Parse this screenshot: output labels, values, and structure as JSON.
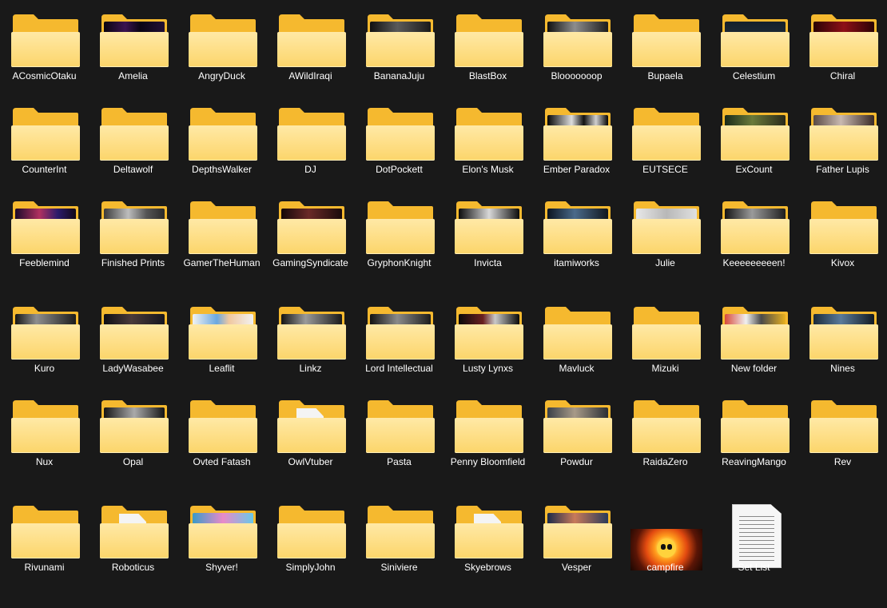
{
  "explorer": {
    "items": [
      {
        "name": "ACosmicOtaku",
        "kind": "folder",
        "preview": ""
      },
      {
        "name": "Amelia",
        "kind": "folder",
        "preview": "linear-gradient(90deg,#09050f,#3b1350 35%,#0a0414 60%,#221035)"
      },
      {
        "name": "AngryDuck",
        "kind": "folder",
        "preview": ""
      },
      {
        "name": "AWildIraqi",
        "kind": "folder",
        "preview": ""
      },
      {
        "name": "BananaJuju",
        "kind": "folder",
        "preview": "linear-gradient(90deg,#101010,#5a5a5a 45%,#1a1a1a)"
      },
      {
        "name": "BlastBox",
        "kind": "folder",
        "preview": ""
      },
      {
        "name": "Blooooooop",
        "kind": "folder",
        "preview": "linear-gradient(90deg,#0f0f0f,#8d8d8d 45%,#1c1c1c)"
      },
      {
        "name": "Bupaela",
        "kind": "folder",
        "preview": ""
      },
      {
        "name": "Celestium",
        "kind": "folder",
        "preview": "linear-gradient(180deg,#15202b,#24313d)"
      },
      {
        "name": "Chiral",
        "kind": "folder",
        "preview": "linear-gradient(90deg,#2a0305,#8e1017 50%,#2a0305)"
      },
      {
        "name": "CounterInt",
        "kind": "folder",
        "preview": ""
      },
      {
        "name": "Deltawolf",
        "kind": "folder",
        "preview": ""
      },
      {
        "name": "DepthsWalker",
        "kind": "folder",
        "preview": ""
      },
      {
        "name": "DJ",
        "kind": "folder",
        "preview": ""
      },
      {
        "name": "DotPockett",
        "kind": "folder",
        "preview": ""
      },
      {
        "name": "Elon's Musk",
        "kind": "folder",
        "preview": ""
      },
      {
        "name": "Ember Paradox",
        "kind": "folder",
        "preview": "linear-gradient(90deg,#050505,#dcdcdc 40%,#111 60%,#cfcfcf 80%,#050505)"
      },
      {
        "name": "EUTSECE",
        "kind": "folder",
        "preview": ""
      },
      {
        "name": "ExCount",
        "kind": "folder",
        "preview": "linear-gradient(90deg,#1a2a1a,#6a7a3a 45%,#2a2a1a)"
      },
      {
        "name": "Father Lupis",
        "kind": "folder",
        "preview": "linear-gradient(90deg,#5a4a45,#c8b8b0 45%,#3a2a26)"
      },
      {
        "name": "Feeblemind",
        "kind": "folder",
        "preview": "linear-gradient(90deg,#1b0b2b,#b03060 40%,#2b1b6b 70%,#120818)"
      },
      {
        "name": "Finished Prints",
        "kind": "folder",
        "preview": "linear-gradient(90deg,#3a3a3a,#bdbdbd 40%,#555 70%,#2a2a2a)"
      },
      {
        "name": "GamerTheHuman",
        "kind": "folder",
        "preview": ""
      },
      {
        "name": "GamingSyndicate",
        "kind": "folder",
        "preview": "linear-gradient(90deg,#140808,#6a2a28 45%,#1a0b0b)"
      },
      {
        "name": "GryphonKnight",
        "kind": "folder",
        "preview": ""
      },
      {
        "name": "Invicta",
        "kind": "folder",
        "preview": "linear-gradient(90deg,#0c0c0c,#d8d8d8 50%,#0c0c0c)"
      },
      {
        "name": "itamiworks",
        "kind": "folder",
        "preview": "linear-gradient(90deg,#0b1420,#4a6a8a 45%,#10161e)"
      },
      {
        "name": "Julie",
        "kind": "folder",
        "preview": "linear-gradient(90deg,#e8e8e8,#b8b8b8 50%,#e0e0e0)"
      },
      {
        "name": "Keeeeeeeeen!",
        "kind": "folder",
        "preview": "linear-gradient(90deg,#141414,#9a9a9a 45%,#1e1e1e)"
      },
      {
        "name": "Kivox",
        "kind": "folder",
        "preview": ""
      },
      {
        "name": "Kuro",
        "kind": "folder",
        "preview": "linear-gradient(90deg,#161616,#8e8e8e 35%,#1c1c1c)"
      },
      {
        "name": "LadyWasabee",
        "kind": "folder",
        "preview": "linear-gradient(90deg,#0e0e14,#4a3a3a 45%,#16161e)"
      },
      {
        "name": "Leaflit",
        "kind": "folder",
        "preview": "linear-gradient(90deg,#f2f2f2,#6aa8e0 40%,#f0c8a0 60%,#f2f2f2)"
      },
      {
        "name": "Linkz",
        "kind": "folder",
        "preview": "linear-gradient(90deg,#141414,#9a9a9a 40%,#1a1a1a)"
      },
      {
        "name": "Lord Intellectual",
        "kind": "folder",
        "preview": "linear-gradient(90deg,#121212,#8a8a8a 45%,#1c1c1c)"
      },
      {
        "name": "Lusty Lynxs",
        "kind": "folder",
        "preview": "linear-gradient(90deg,#0a0a0a,#6a2020 40%,#c8c8c8 60%,#0a0a0a)"
      },
      {
        "name": "Mavluck",
        "kind": "folder",
        "preview": ""
      },
      {
        "name": "Mizuki",
        "kind": "folder",
        "preview": ""
      },
      {
        "name": "New folder",
        "kind": "folder",
        "preview": "linear-gradient(90deg,#d84a3a,#f0f0f0 35%,#4a4a4a 60%,#e8b020)"
      },
      {
        "name": "Nines",
        "kind": "folder",
        "preview": "linear-gradient(90deg,#1a2a3a,#5a7a9a 45%,#121a22)"
      },
      {
        "name": "Nux",
        "kind": "folder",
        "preview": ""
      },
      {
        "name": "Opal",
        "kind": "folder",
        "preview": "linear-gradient(90deg,#151515,#aaaaaa 50%,#151515)"
      },
      {
        "name": "Ovted Fatash",
        "kind": "folder",
        "preview": ""
      },
      {
        "name": "OwlVtuber",
        "kind": "folder-doc",
        "preview": ""
      },
      {
        "name": "Pasta",
        "kind": "folder",
        "preview": ""
      },
      {
        "name": "Penny Bloomfield",
        "kind": "folder",
        "preview": ""
      },
      {
        "name": "Powdur",
        "kind": "folder",
        "preview": "linear-gradient(90deg,#3a4048,#a89a88 45%,#2a2e34)"
      },
      {
        "name": "RaidaZero",
        "kind": "folder",
        "preview": ""
      },
      {
        "name": "ReavingMango",
        "kind": "folder",
        "preview": ""
      },
      {
        "name": "Rev",
        "kind": "folder",
        "preview": ""
      },
      {
        "name": "Rivunami",
        "kind": "folder",
        "preview": ""
      },
      {
        "name": "Roboticus",
        "kind": "folder-doc",
        "preview": ""
      },
      {
        "name": "Shyver!",
        "kind": "folder",
        "preview": "linear-gradient(90deg,#3a9ac8,#e88ac8 50%,#6ac8e8)"
      },
      {
        "name": "SimplyJohn",
        "kind": "folder",
        "preview": ""
      },
      {
        "name": "Siniviere",
        "kind": "folder",
        "preview": ""
      },
      {
        "name": "Skyebrows",
        "kind": "folder-app",
        "preview": ""
      },
      {
        "name": "Vesper",
        "kind": "folder",
        "preview": "linear-gradient(90deg,#1a2a4a,#c87a5a 45%,#2a3a5a)"
      },
      {
        "name": "campfire",
        "kind": "image",
        "preview": ""
      },
      {
        "name": "Set List",
        "kind": "text",
        "preview": ""
      }
    ]
  },
  "colors": {
    "background": "#191919",
    "folder_front": "#fcd56a",
    "folder_back": "#f5b92f",
    "label": "#ffffff"
  }
}
